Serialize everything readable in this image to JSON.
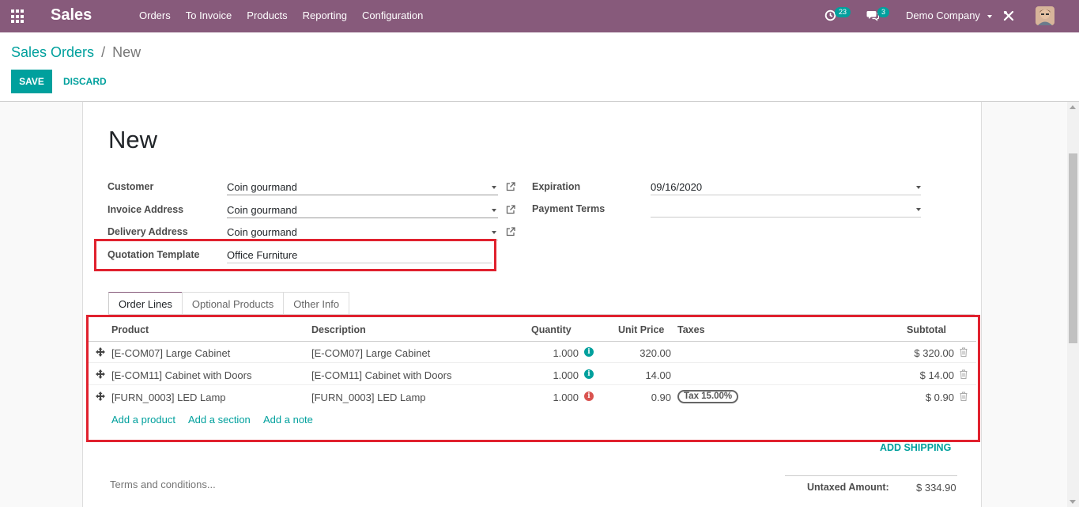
{
  "navbar": {
    "app_name": "Sales",
    "menu": [
      "Orders",
      "To Invoice",
      "Products",
      "Reporting",
      "Configuration"
    ],
    "activity_count": "23",
    "message_count": "3",
    "company": "Demo Company",
    "bg_color": "#875a7b"
  },
  "breadcrumb": {
    "parent": "Sales Orders",
    "separator": "/",
    "current": "New"
  },
  "buttons": {
    "save": "SAVE",
    "discard": "DISCARD",
    "accent_color": "#00a09d"
  },
  "form": {
    "title": "New",
    "customer_label": "Customer",
    "customer_value": "Coin gourmand",
    "invoice_address_label": "Invoice Address",
    "invoice_address_value": "Coin gourmand",
    "delivery_address_label": "Delivery Address",
    "delivery_address_value": "Coin gourmand",
    "quotation_template_label": "Quotation Template",
    "quotation_template_value": "Office Furniture",
    "expiration_label": "Expiration",
    "expiration_value": "09/16/2020",
    "payment_terms_label": "Payment Terms",
    "payment_terms_value": ""
  },
  "tabs": [
    "Order Lines",
    "Optional Products",
    "Other Info"
  ],
  "order_lines": {
    "headers": {
      "product": "Product",
      "description": "Description",
      "quantity": "Quantity",
      "unit_price": "Unit Price",
      "taxes": "Taxes",
      "subtotal": "Subtotal"
    },
    "rows": [
      {
        "product": "[E-COM07] Large Cabinet",
        "description": "[E-COM07] Large Cabinet",
        "quantity": "1.000",
        "unit_price": "320.00",
        "tax": "",
        "subtotal": "$ 320.00",
        "info_color": "#00a09d"
      },
      {
        "product": "[E-COM11] Cabinet with Doors",
        "description": "[E-COM11] Cabinet with Doors",
        "quantity": "1.000",
        "unit_price": "14.00",
        "tax": "",
        "subtotal": "$ 14.00",
        "info_color": "#00a09d"
      },
      {
        "product": "[FURN_0003] LED Lamp",
        "description": "[FURN_0003] LED Lamp",
        "quantity": "1.000",
        "unit_price": "0.90",
        "tax": "Tax 15.00%",
        "subtotal": "$ 0.90",
        "info_color": "#d9534f"
      }
    ],
    "add_product": "Add a product",
    "add_section": "Add a section",
    "add_note": "Add a note"
  },
  "add_shipping": "ADD SHIPPING",
  "terms_placeholder": "Terms and conditions...",
  "totals": {
    "untaxed_label": "Untaxed Amount:",
    "untaxed_value": "$ 334.90"
  },
  "highlight_color": "#e0212e"
}
